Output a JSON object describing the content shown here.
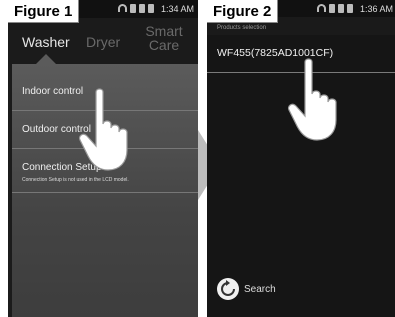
{
  "figures": [
    {
      "label": "Figure 1",
      "status": {
        "time": "1:34 AM"
      },
      "tabs": {
        "washer": "Washer",
        "dryer": "Dryer",
        "smart_care": "Smart\nCare"
      },
      "menu": [
        {
          "label": "Indoor control"
        },
        {
          "label": "Outdoor control"
        },
        {
          "label": "Connection Setup",
          "sub": "Connection Setup is not used in the LCD model."
        }
      ]
    },
    {
      "label": "Figure 2",
      "status": {
        "time": "1:36 AM"
      },
      "header": "Products selection",
      "device": "WF455(7825AD1001CF)",
      "search": "Search"
    }
  ]
}
